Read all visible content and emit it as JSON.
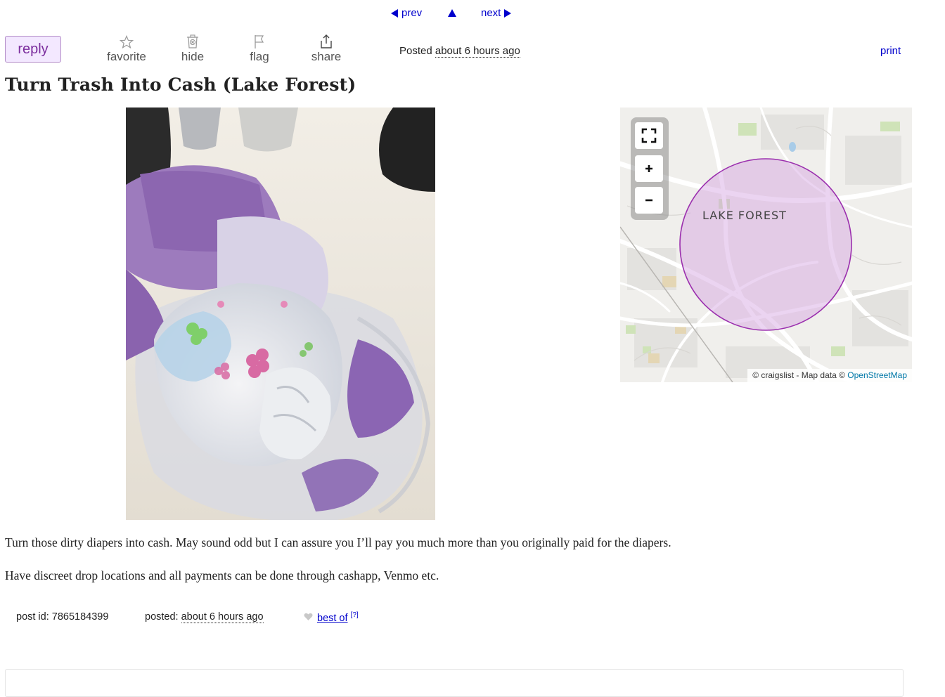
{
  "nav": {
    "prev_label": "prev",
    "next_label": "next"
  },
  "actions": {
    "reply_label": "reply",
    "favorite_label": "favorite",
    "hide_label": "hide",
    "flag_label": "flag",
    "share_label": "share",
    "print_label": "print"
  },
  "posted": {
    "prefix": "Posted",
    "time": "about 6 hours ago"
  },
  "listing": {
    "title": "Turn Trash Into Cash (Lake Forest)",
    "body": [
      "Turn those dirty diapers into cash. May sound odd but I can assure you I’ll pay you much more than you originally paid for the diapers.",
      "Have discreet drop locations and all payments can be done through cashapp, Venmo etc."
    ]
  },
  "map": {
    "place_label": "LAKE FOREST",
    "attribution": "© craigslist - Map data ©",
    "attribution_link": "OpenStreetMap"
  },
  "footer": {
    "post_id_label": "post id: 7865184399",
    "posted_label": "posted:",
    "posted_time": "about 6 hours ago",
    "best_of_label": "best of",
    "help_label": "[?]"
  },
  "colors": {
    "link": "#0000cc",
    "reply_bg": "#f3e8ff",
    "reply_text": "#7b2d9e",
    "map_circle": "#9b2fae"
  }
}
